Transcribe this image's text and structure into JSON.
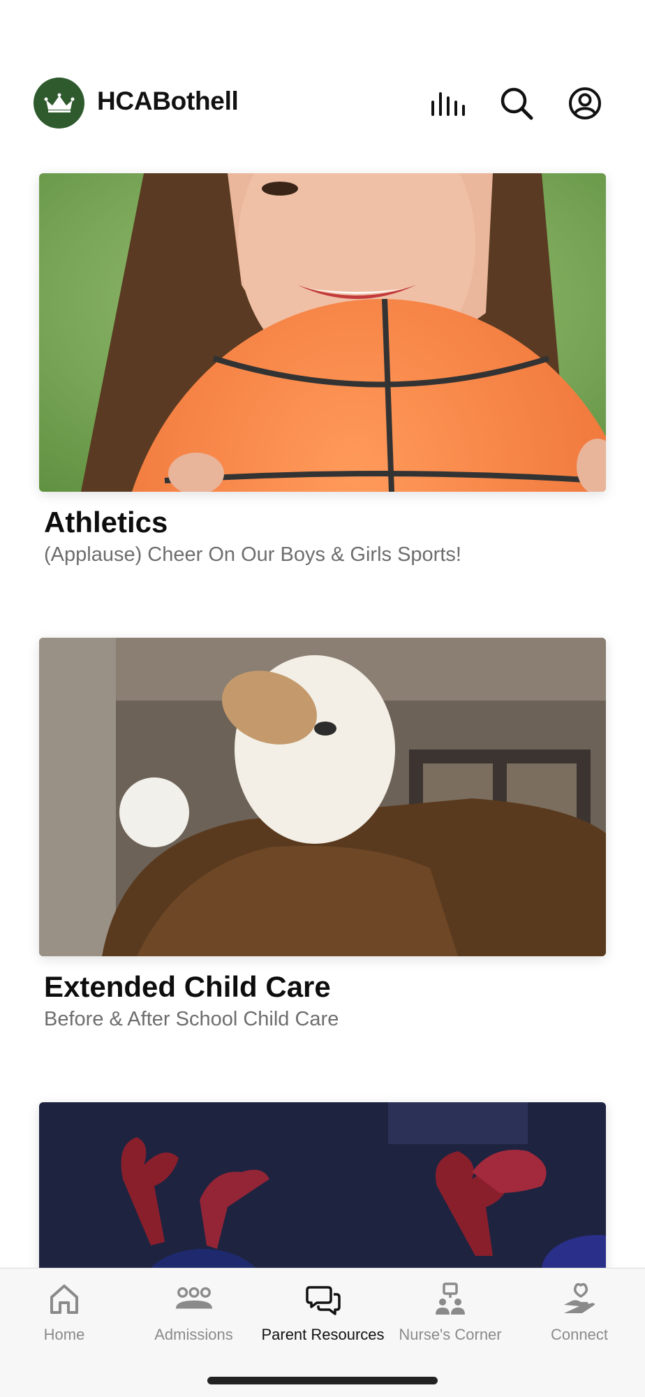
{
  "header": {
    "app_title": "HCABothell",
    "logo_icon": "crown-icon",
    "icons": [
      "bar-chart-icon",
      "search-icon",
      "profile-icon"
    ]
  },
  "cards": [
    {
      "title": "Athletics",
      "subtitle": "(Applause) Cheer On Our Boys & Girls Sports!",
      "image": "girl-holding-basketball-photo"
    },
    {
      "title": "Extended Child Care",
      "subtitle": "Before & After School Child Care",
      "image": "eagle-mascot-photo"
    },
    {
      "title": "",
      "subtitle": "",
      "image": "reindeer-antlers-crowd-photo"
    }
  ],
  "tabbar": {
    "tabs": [
      {
        "label": "Home",
        "icon": "house-icon",
        "active": false
      },
      {
        "label": "Admissions",
        "icon": "people-group-icon",
        "active": false
      },
      {
        "label": "Parent Resources",
        "icon": "chat-bubbles-icon",
        "active": true
      },
      {
        "label": "Nurse's Corner",
        "icon": "nurse-corner-icon",
        "active": false
      },
      {
        "label": "Connect",
        "icon": "heart-hand-icon",
        "active": false
      }
    ]
  },
  "colors": {
    "brand_green": "#2e5a2e",
    "active_tab": "#111111",
    "inactive_tab": "#8a8a8a",
    "subtitle_gray": "#6d6d6d"
  }
}
